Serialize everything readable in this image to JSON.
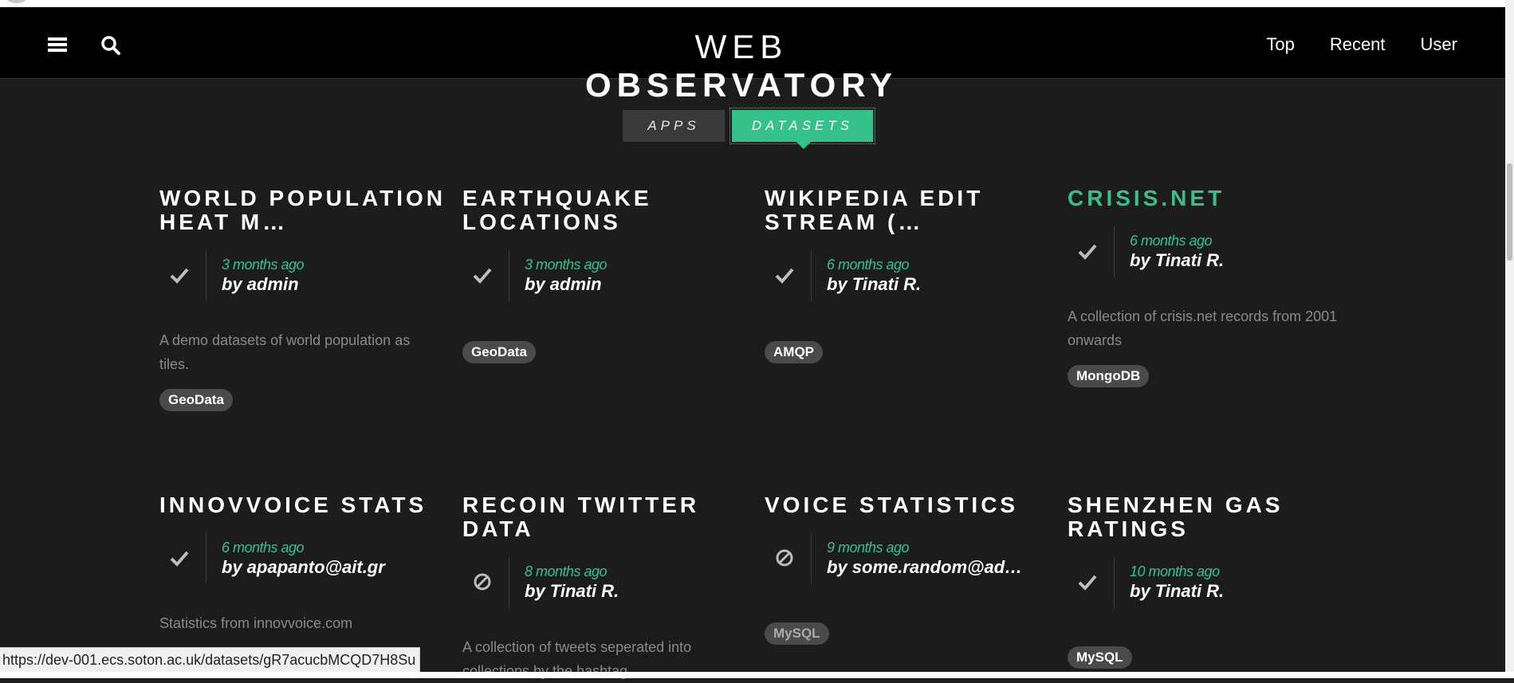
{
  "header": {
    "brand_light": "WEB",
    "brand_bold": "OBSERVATORY",
    "nav": [
      {
        "label": "Top"
      },
      {
        "label": "Recent"
      },
      {
        "label": "User"
      }
    ]
  },
  "tabs": {
    "apps": "APPS",
    "datasets": "DATASETS",
    "selected": "DATASETS"
  },
  "cards": [
    {
      "title": "WORLD POPULATION HEAT M…",
      "time": "3 months ago",
      "by": "by admin",
      "status": "check",
      "description": "A demo datasets of world population as tiles.",
      "tag": "GeoData"
    },
    {
      "title": "EARTHQUAKE LOCATIONS",
      "time": "3 months ago",
      "by": "by admin",
      "status": "check",
      "description": "",
      "tag": "GeoData"
    },
    {
      "title": "WIKIPEDIA EDIT STREAM (…",
      "time": "6 months ago",
      "by": "by Tinati R.",
      "status": "check",
      "description": "",
      "tag": "AMQP"
    },
    {
      "title": "CRISIS.NET",
      "time": "6 months ago",
      "by": "by Tinati R.",
      "status": "check",
      "description": "A collection of crisis.net records from 2001 onwards",
      "tag": "MongoDB"
    },
    {
      "title": "INNOVVOICE STATS",
      "time": "6 months ago",
      "by": "by apapanto@ait.gr",
      "status": "check",
      "description": "Statistics from innovvoice.com",
      "tag": ""
    },
    {
      "title": "RECOIN TWITTER DATA",
      "time": "8 months ago",
      "by": "by Tinati R.",
      "status": "blocked",
      "description": "A collection of tweets seperated into collections by the hashtag",
      "tag": ""
    },
    {
      "title": "VOICE STATISTICS",
      "time": "9 months ago",
      "by": "by some.random@ad…",
      "status": "blocked",
      "description": "",
      "tag": "MySQL"
    },
    {
      "title": "SHENZHEN GAS RATINGS",
      "time": "10 months ago",
      "by": "by Tinati R.",
      "status": "check",
      "description": "",
      "tag": "MySQL"
    }
  ],
  "status_bar": {
    "url": "https://dev-001.ecs.soton.ac.uk/datasets/gR7acucbMCQD7H8Su"
  },
  "colors": {
    "accent": "#34c28a",
    "background": "#1c1c1c",
    "header": "#000000"
  }
}
